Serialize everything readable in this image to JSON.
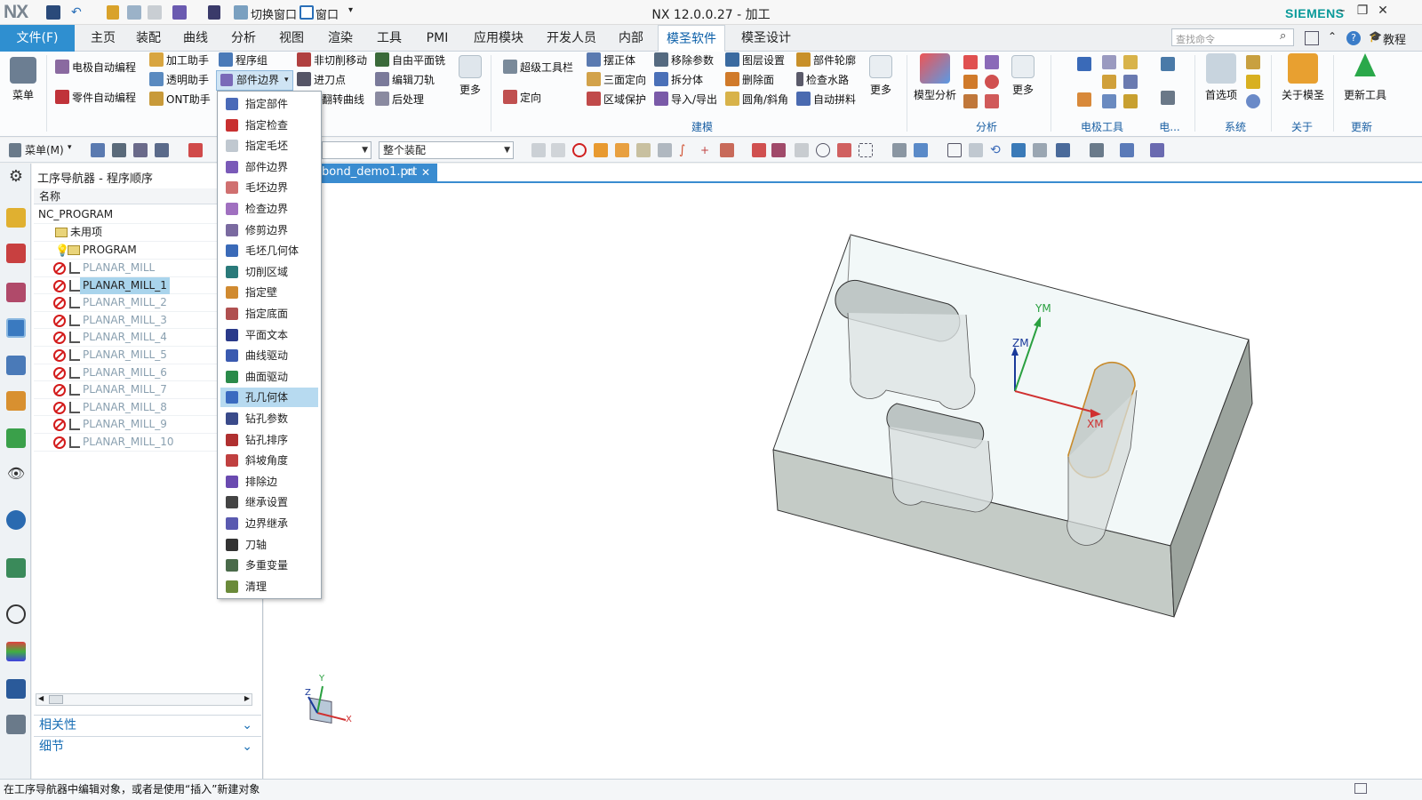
{
  "app": {
    "logo": "NX",
    "title": "NX 12.0.0.27 - 加工",
    "brand": "SIEMENS",
    "quick_access": {
      "switch_window": "切换窗口",
      "window": "窗口"
    }
  },
  "tabs": [
    "文件(F)",
    "主页",
    "装配",
    "曲线",
    "分析",
    "视图",
    "渲染",
    "工具",
    "PMI",
    "应用模块",
    "开发人员",
    "内部",
    "模圣软件",
    "模圣设计"
  ],
  "active_tab": "模圣软件",
  "search_placeholder": "查找命令",
  "tutorial_label": "教程",
  "ribbon": {
    "menu_label": "菜单",
    "col1": [
      "电极自动编程",
      "零件自动编程"
    ],
    "col2": [
      "加工助手",
      "透明助手",
      "ONT助手"
    ],
    "col3": [
      "程序组",
      "部件边界"
    ],
    "col4": [
      "非切削移动",
      "进刀点",
      "翻转曲线"
    ],
    "col5": [
      "自由平面铣",
      "编辑刀轨",
      "后处理"
    ],
    "more": "更多",
    "col6": [
      "超级工具栏",
      "定向"
    ],
    "col7": [
      "摆正体",
      "三面定向",
      "区域保护"
    ],
    "col8": [
      "移除参数",
      "拆分体",
      "导入/导出"
    ],
    "col9": [
      "图层设置",
      "删除面",
      "圆角/斜角"
    ],
    "col10": [
      "部件轮廓",
      "检查水路",
      "自动拼料"
    ],
    "model_analysis": "模型分析",
    "prefs": "首选项",
    "about": "关于模圣",
    "update_tool": "更新工具",
    "groups": [
      "建模",
      "分析",
      "电极工具",
      "电...",
      "系统",
      "关于",
      "更新"
    ]
  },
  "toolbar2": {
    "menu_label": "菜单(M)",
    "assembly_combo": "整个装配",
    "file_tab": "bond_demo1.prt"
  },
  "navigator": {
    "title": "工序导航器 - 程序顺序",
    "column_name": "名称",
    "root": "NC_PROGRAM",
    "unused": "未用项",
    "program": "PROGRAM",
    "operations": [
      "PLANAR_MILL",
      "PLANAR_MILL_1",
      "PLANAR_MILL_2",
      "PLANAR_MILL_3",
      "PLANAR_MILL_4",
      "PLANAR_MILL_5",
      "PLANAR_MILL_6",
      "PLANAR_MILL_7",
      "PLANAR_MILL_8",
      "PLANAR_MILL_9",
      "PLANAR_MILL_10"
    ],
    "selected": "PLANAR_MILL_1",
    "panels": [
      "相关性",
      "细节"
    ]
  },
  "dropdown": {
    "trigger": "部件边界",
    "items": [
      "指定部件",
      "指定检查",
      "指定毛坯",
      "部件边界",
      "毛坯边界",
      "检查边界",
      "修剪边界",
      "毛坯几何体",
      "切削区域",
      "指定壁",
      "指定底面",
      "平面文本",
      "曲线驱动",
      "曲面驱动",
      "孔几何体",
      "钻孔参数",
      "钻孔排序",
      "斜坡角度",
      "排除边",
      "继承设置",
      "边界继承",
      "刀轴",
      "多重变量",
      "清理"
    ],
    "highlighted": "孔几何体"
  },
  "graphics": {
    "csys_labels": {
      "ym": "YM",
      "zm": "ZM",
      "xm": "XM"
    },
    "triad_labels": {
      "y": "Y",
      "z": "Z",
      "x": "X"
    }
  },
  "status": "在工序导航器中编辑对象，或者是使用“插入”新建对象",
  "colors": {
    "accent": "#2f8fd0",
    "selection": "#a9d4ec",
    "brand": "#0a9a9a"
  }
}
